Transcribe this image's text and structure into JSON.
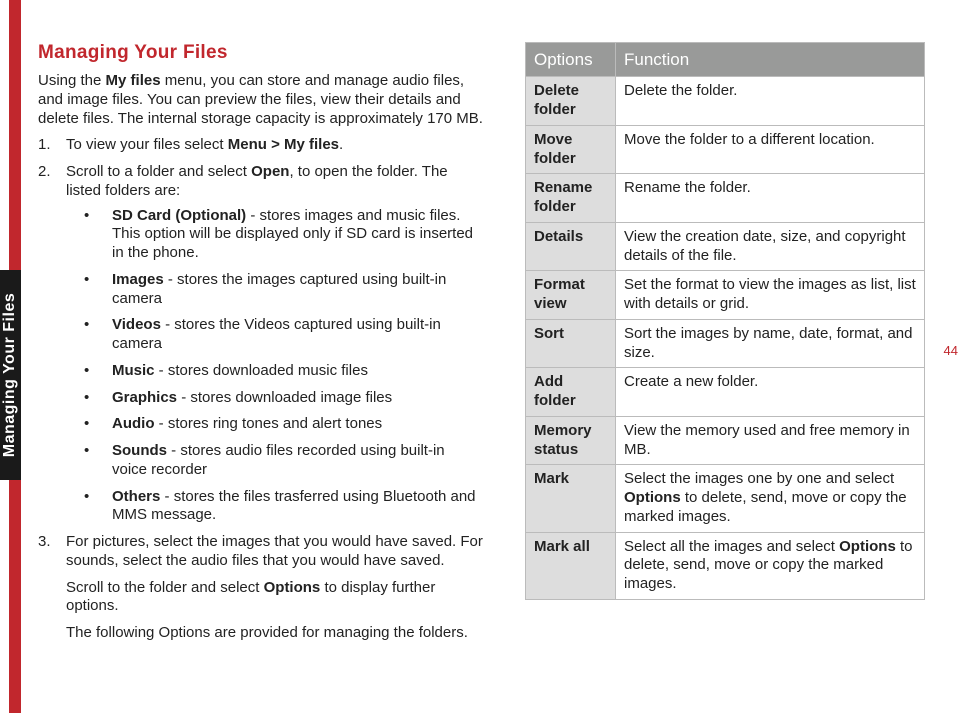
{
  "sideTab": "Managing Your Files",
  "pageNum": "44",
  "heading": "Managing Your Files",
  "intro_1": "Using the ",
  "intro_bold_myfiles": "My files",
  "intro_2": " menu, you can store and manage audio files, and image files. You can preview the files, view their details and delete files. The internal storage capacity is approximately 170 MB.",
  "step1_num": "1.",
  "step1_a": "To view your files select ",
  "step1_bold": "Menu > My files",
  "step1_b": ".",
  "step2_num": "2.",
  "step2_a": "Scroll to a folder and select ",
  "step2_bold": "Open",
  "step2_b": ", to open the folder. The listed folders are:",
  "bullets": [
    {
      "b": "SD Card (Optional)",
      "sep": " -  ",
      "t": "stores images and music files. This option will be displayed only if SD card is inserted in the phone."
    },
    {
      "b": "Images",
      "sep": " - ",
      "t": "stores the images captured using built-in camera"
    },
    {
      "b": "Videos",
      "sep": " - ",
      "t": "stores the Videos captured using built-in camera"
    },
    {
      "b": "Music",
      "sep": " - ",
      "t": "stores downloaded music files"
    },
    {
      "b": "Graphics",
      "sep": " - ",
      "t": "stores downloaded image files"
    },
    {
      "b": "Audio",
      "sep": " - ",
      "t": "stores ring tones and alert tones"
    },
    {
      "b": "Sounds",
      "sep": " - ",
      "t": "stores audio files recorded using built-in voice recorder"
    },
    {
      "b": "Others",
      "sep": " - ",
      "t": "stores the files trasferred using Bluetooth and MMS message."
    }
  ],
  "step3_num": "3.",
  "step3_p1": "For pictures, select the images that you would have saved. For sounds, select the audio files that you would have saved.",
  "step3_p2a": "Scroll to the folder and select ",
  "step3_p2bold": "Options",
  "step3_p2b": " to display further options.",
  "step3_p3": "The following Options are provided for managing the folders.",
  "table": {
    "h1": "Options",
    "h2": "Function",
    "rows": [
      {
        "opt": "Delete folder",
        "fn_a": "Delete the folder.",
        "bold": "",
        "fn_b": ""
      },
      {
        "opt": "Move folder",
        "fn_a": "Move the folder to a different location.",
        "bold": "",
        "fn_b": ""
      },
      {
        "opt": "Rename folder",
        "fn_a": "Rename the folder.",
        "bold": "",
        "fn_b": ""
      },
      {
        "opt": "Details",
        "fn_a": "View the creation date, size, and copyright details of the file.",
        "bold": "",
        "fn_b": ""
      },
      {
        "opt": "Format view",
        "fn_a": "Set the format to view the images as list, list with details or grid.",
        "bold": "",
        "fn_b": ""
      },
      {
        "opt": "Sort",
        "fn_a": "Sort the images by name, date, format, and size.",
        "bold": "",
        "fn_b": ""
      },
      {
        "opt": "Add folder",
        "fn_a": "Create a new folder.",
        "bold": "",
        "fn_b": ""
      },
      {
        "opt": "Memory status",
        "fn_a": "View the memory used and free memory in MB.",
        "bold": "",
        "fn_b": ""
      },
      {
        "opt": "Mark",
        "fn_a": "Select the images one by one and select ",
        "bold": "Options",
        "fn_b": " to delete, send, move or copy the marked images."
      },
      {
        "opt": "Mark all",
        "fn_a": "Select all the images and select ",
        "bold": "Options",
        "fn_b": " to delete, send, move or copy the marked images."
      }
    ]
  }
}
